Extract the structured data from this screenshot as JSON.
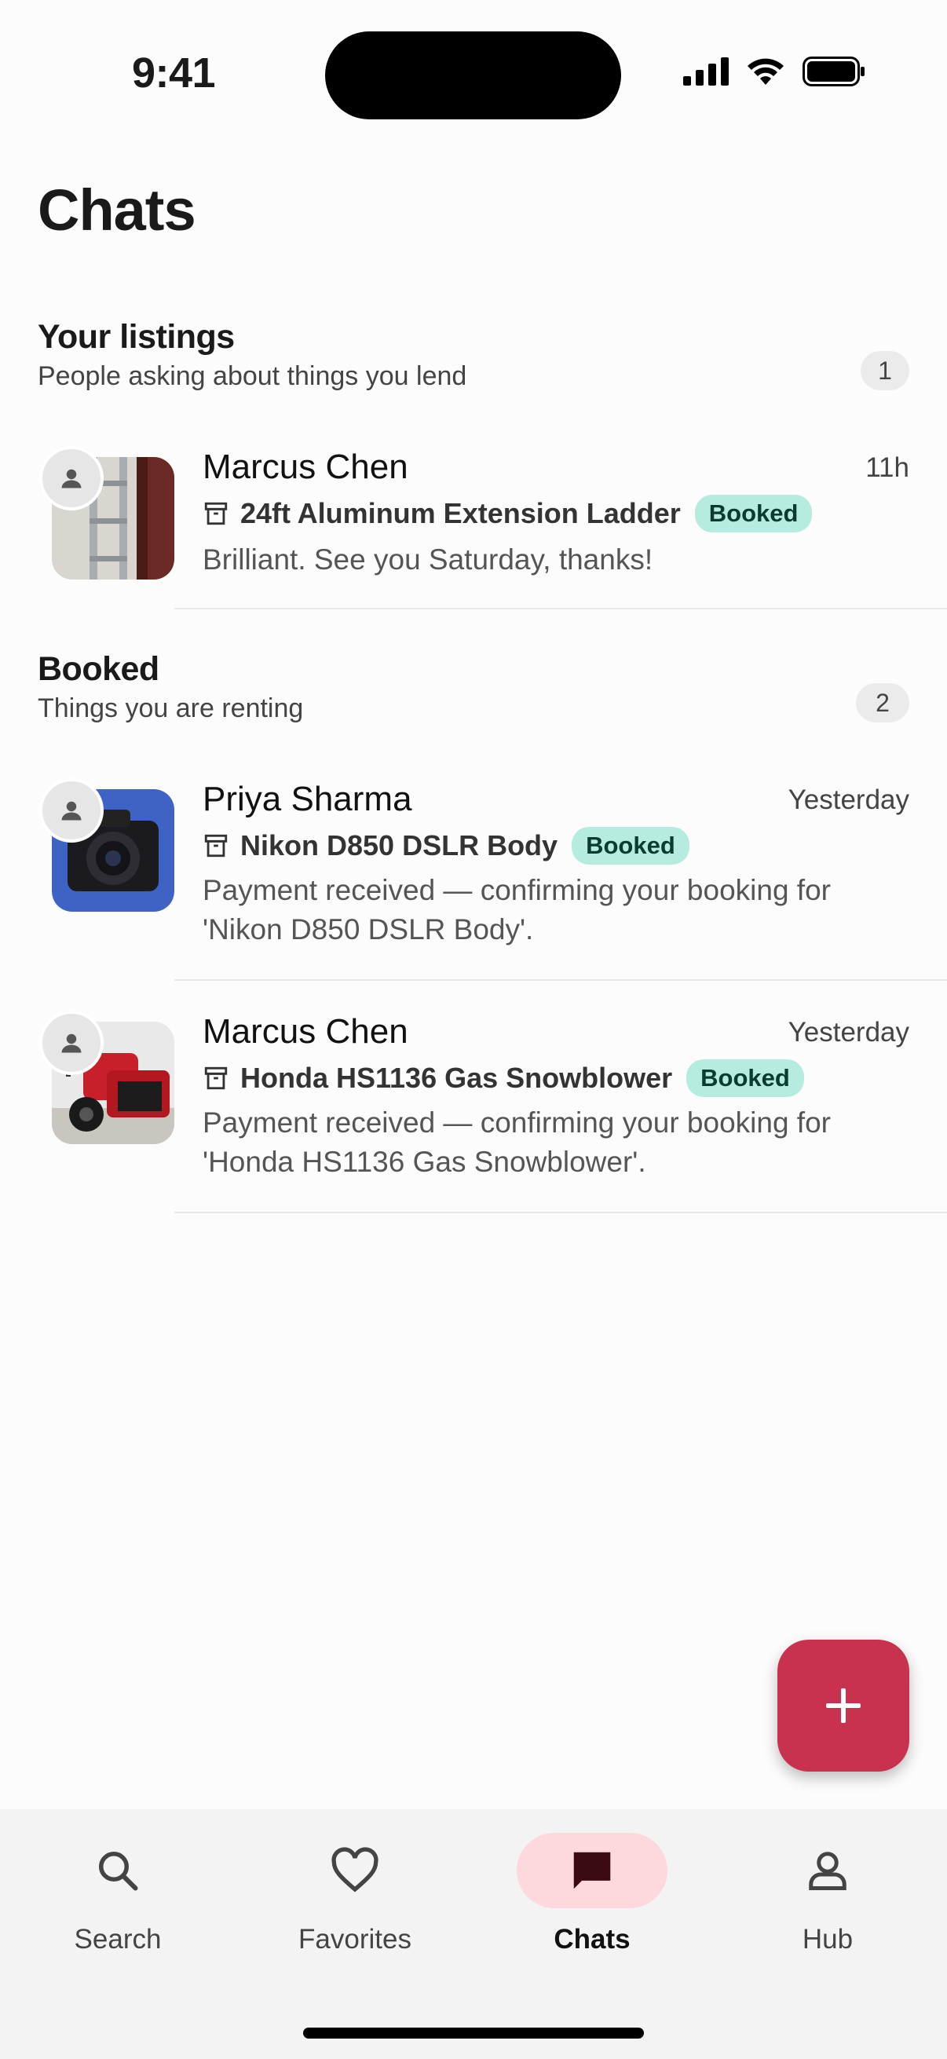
{
  "status_bar": {
    "time": "9:41"
  },
  "page_title": "Chats",
  "sections": [
    {
      "title": "Your listings",
      "subtitle": "People asking about things you lend",
      "count": "1",
      "chats": [
        {
          "name": "Marcus Chen",
          "time": "11h",
          "item": "24ft Aluminum Extension Ladder",
          "status": "Booked",
          "preview": "Brilliant. See you Saturday, thanks!"
        }
      ]
    },
    {
      "title": "Booked",
      "subtitle": "Things you are renting",
      "count": "2",
      "chats": [
        {
          "name": "Priya Sharma",
          "time": "Yesterday",
          "item": "Nikon D850 DSLR Body",
          "status": "Booked",
          "preview": "Payment received — confirming your booking for 'Nikon D850 DSLR Body'."
        },
        {
          "name": "Marcus Chen",
          "time": "Yesterday",
          "item": "Honda HS1136 Gas Snowblower",
          "status": "Booked",
          "preview": "Payment received — confirming your booking for 'Honda HS1136 Gas Snowblower'."
        }
      ]
    }
  ],
  "fab": {
    "icon": "plus-icon"
  },
  "bottom_nav": [
    {
      "label": "Search",
      "icon": "search-icon"
    },
    {
      "label": "Favorites",
      "icon": "heart-icon"
    },
    {
      "label": "Chats",
      "icon": "chat-bubble-icon",
      "active": true
    },
    {
      "label": "Hub",
      "icon": "person-icon"
    }
  ],
  "colors": {
    "accent": "#c8324f",
    "badge_bg": "#b5ecdf",
    "nav_active_bg": "#fdd8dc"
  }
}
